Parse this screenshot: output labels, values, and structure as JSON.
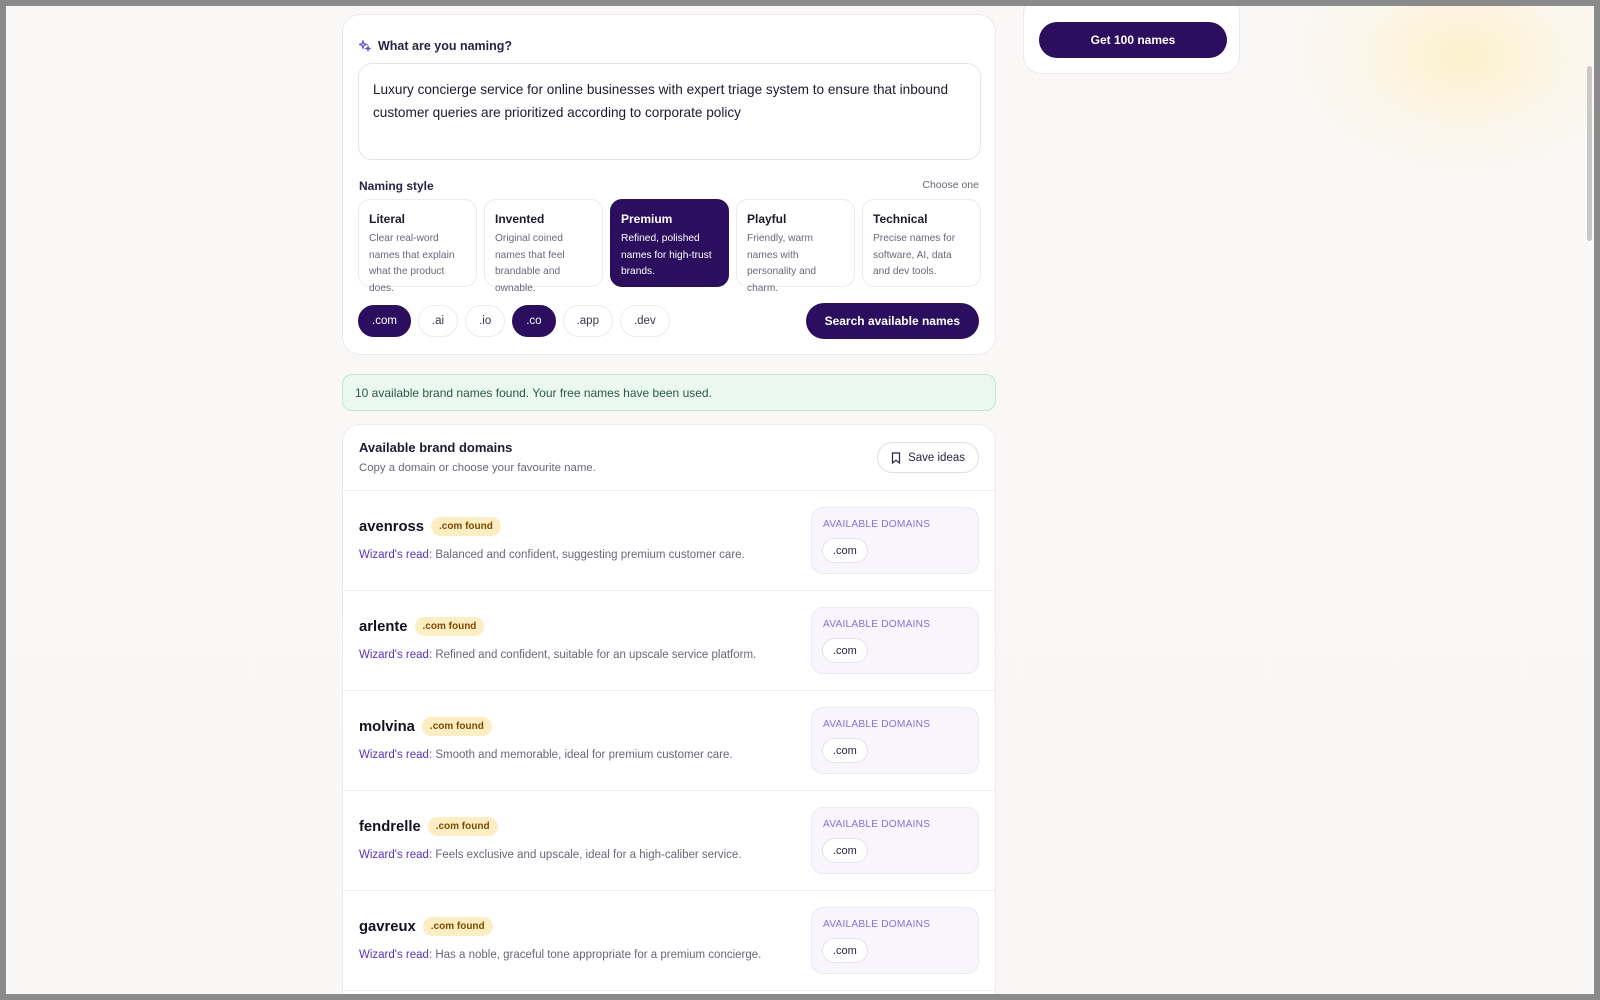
{
  "question": {
    "label": "What are you naming?",
    "value": "Luxury concierge service for online businesses with expert triage system to ensure that inbound customer queries are prioritized according to corporate policy"
  },
  "naming_style": {
    "title": "Naming style",
    "hint": "Choose one",
    "options": [
      {
        "title": "Literal",
        "desc": "Clear real-word names that explain what the product does."
      },
      {
        "title": "Invented",
        "desc": "Original coined names that feel brandable and ownable."
      },
      {
        "title": "Premium",
        "desc": "Refined, polished names for high-trust brands."
      },
      {
        "title": "Playful",
        "desc": "Friendly, warm names with personality and charm."
      },
      {
        "title": "Technical",
        "desc": "Precise names for software, AI, data and dev tools."
      }
    ],
    "selected": "Premium"
  },
  "tlds": [
    {
      "label": ".com",
      "on": true
    },
    {
      "label": ".ai",
      "on": false
    },
    {
      "label": ".io",
      "on": false
    },
    {
      "label": ".co",
      "on": true
    },
    {
      "label": ".app",
      "on": false
    },
    {
      "label": ".dev",
      "on": false
    }
  ],
  "search_button": "Search available names",
  "get_button": "Get 100 names",
  "notice": "10 available brand names found. Your free names have been used.",
  "results": {
    "title": "Available brand domains",
    "subtitle": "Copy a domain or choose your favourite name.",
    "save_label": "Save ideas",
    "read_label": "Wizard's read",
    "domains_heading": "AVAILABLE DOMAINS",
    "items": [
      {
        "name": "avenross",
        "badge": ".com found",
        "read": ": Balanced and confident, suggesting premium customer care.",
        "domain": ".com"
      },
      {
        "name": "arlente",
        "badge": ".com found",
        "read": ": Refined and confident, suitable for an upscale service platform.",
        "domain": ".com"
      },
      {
        "name": "molvina",
        "badge": ".com found",
        "read": ": Smooth and memorable, ideal for premium customer care.",
        "domain": ".com"
      },
      {
        "name": "fendrelle",
        "badge": ".com found",
        "read": ": Feels exclusive and upscale, ideal for a high-caliber service.",
        "domain": ".com"
      },
      {
        "name": "gavreux",
        "badge": ".com found",
        "read": ": Has a noble, graceful tone appropriate for a premium concierge.",
        "domain": ".com"
      }
    ]
  },
  "colors": {
    "brand": "#2b0f5e",
    "accent": "#5a34b8",
    "badge_bg": "#fcedc2",
    "notice_bg": "#eaf8f1"
  }
}
